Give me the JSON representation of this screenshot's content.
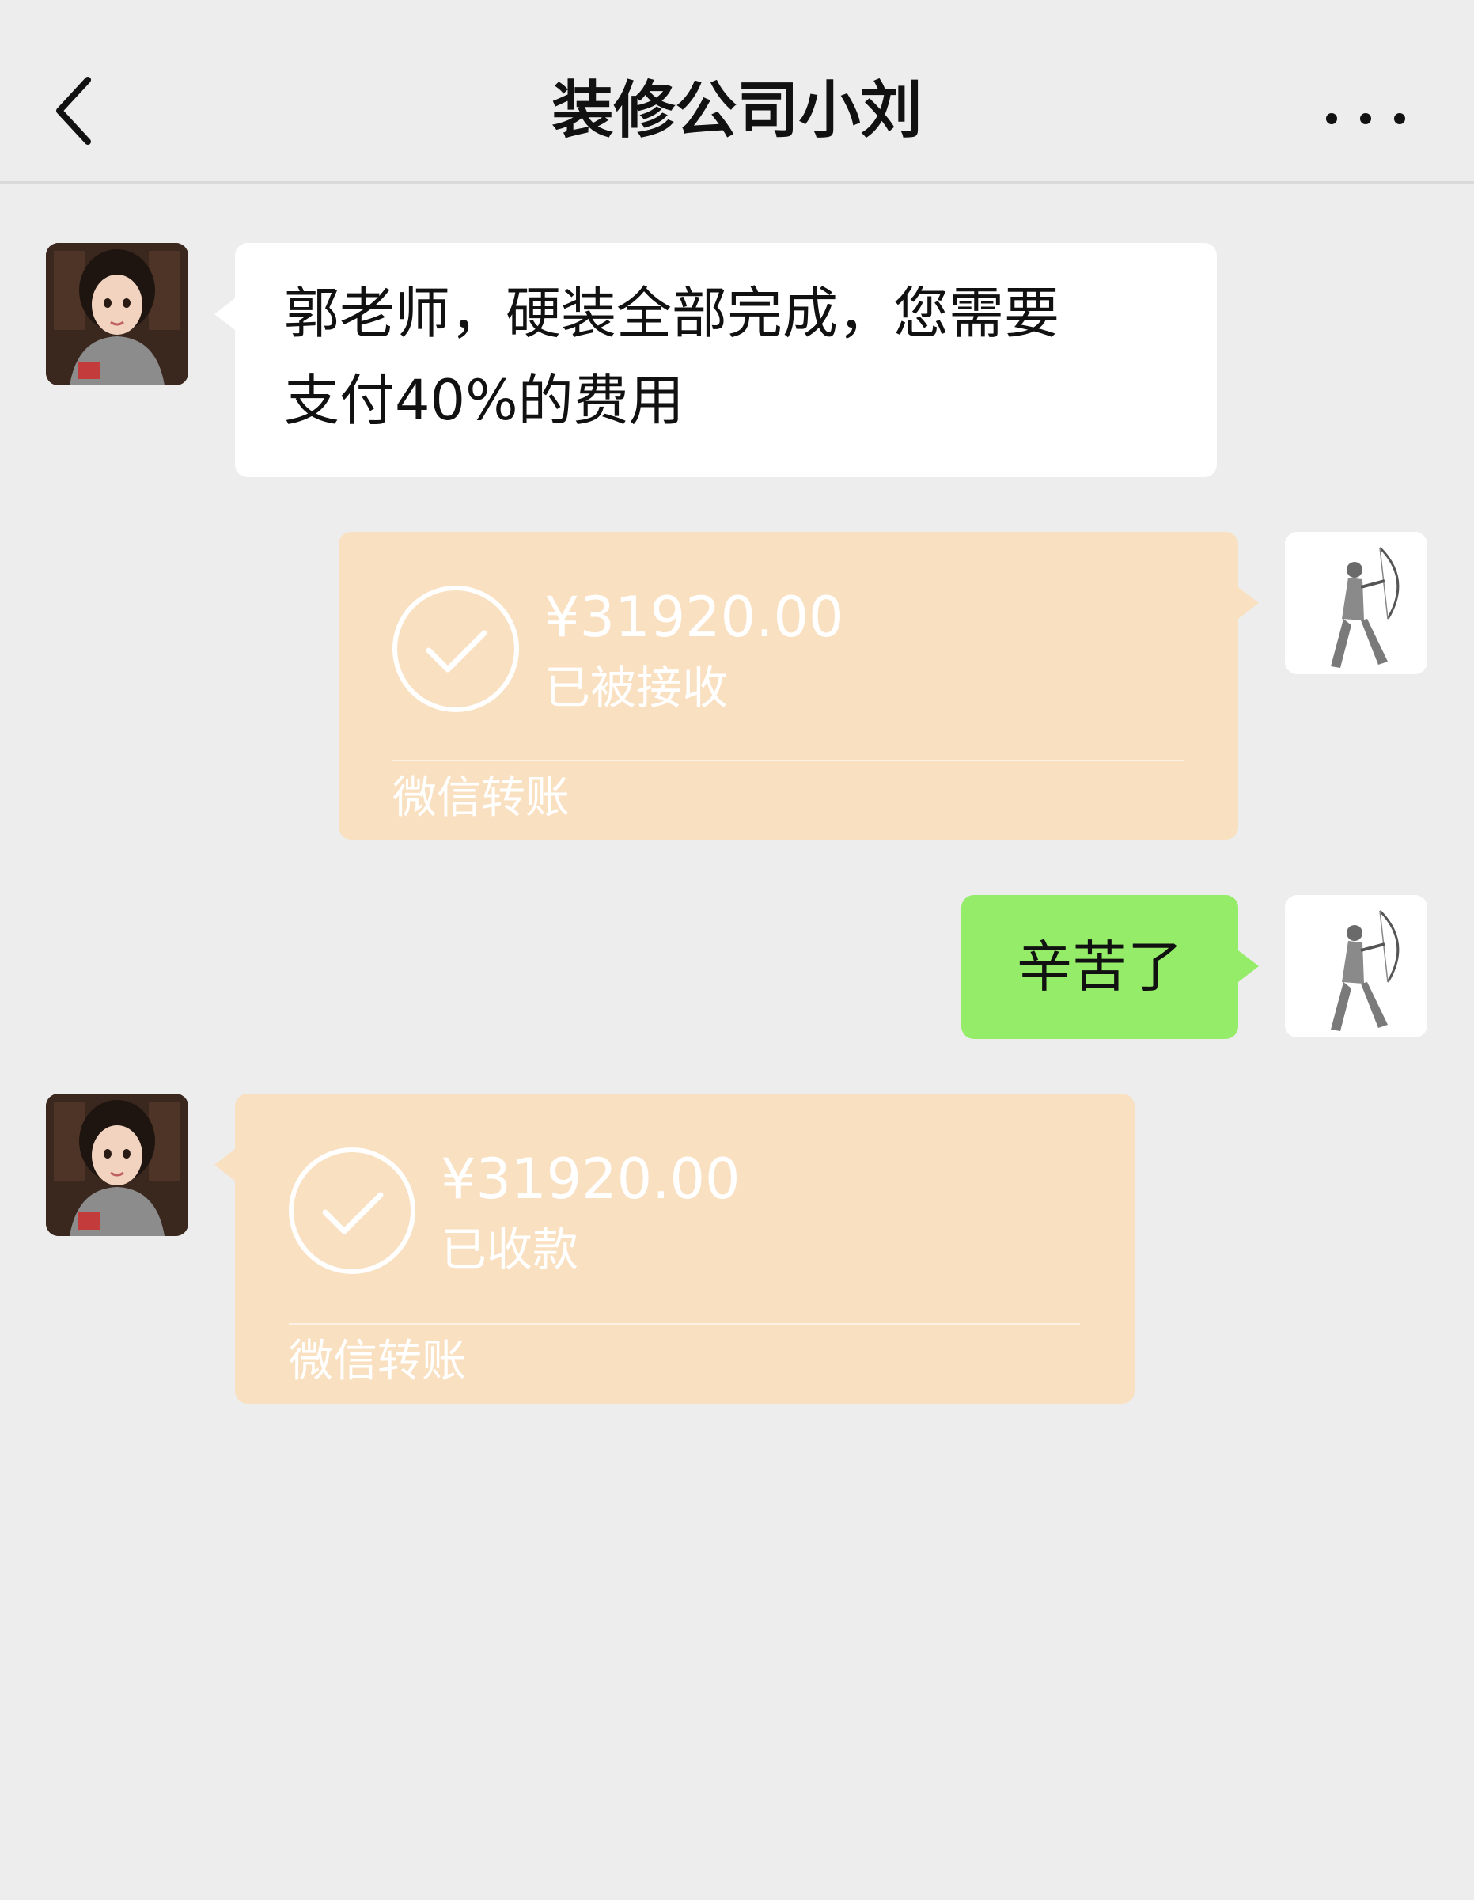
{
  "header": {
    "title": "装修公司小刘",
    "back_icon": "chevron-left-icon",
    "more_icon": "more-dots-icon"
  },
  "messages": [
    {
      "side": "left",
      "type": "text",
      "avatar": "contact-avatar",
      "text_line1": "郭老师，硬装全部完成，您需要",
      "text_line2": "支付40%的费用"
    },
    {
      "side": "right",
      "type": "transfer",
      "avatar": "user-avatar",
      "amount": "¥31920.00",
      "status": "已被接收",
      "label": "微信转账"
    },
    {
      "side": "right",
      "type": "text",
      "avatar": "user-avatar",
      "text": "辛苦了"
    },
    {
      "side": "left",
      "type": "transfer",
      "avatar": "contact-avatar",
      "amount": "¥31920.00",
      "status": "已收款",
      "label": "微信转账"
    }
  ],
  "colors": {
    "background": "#ededed",
    "incoming_bubble": "#ffffff",
    "outgoing_bubble": "#95ec69",
    "transfer_done": "#f9e0c1"
  }
}
